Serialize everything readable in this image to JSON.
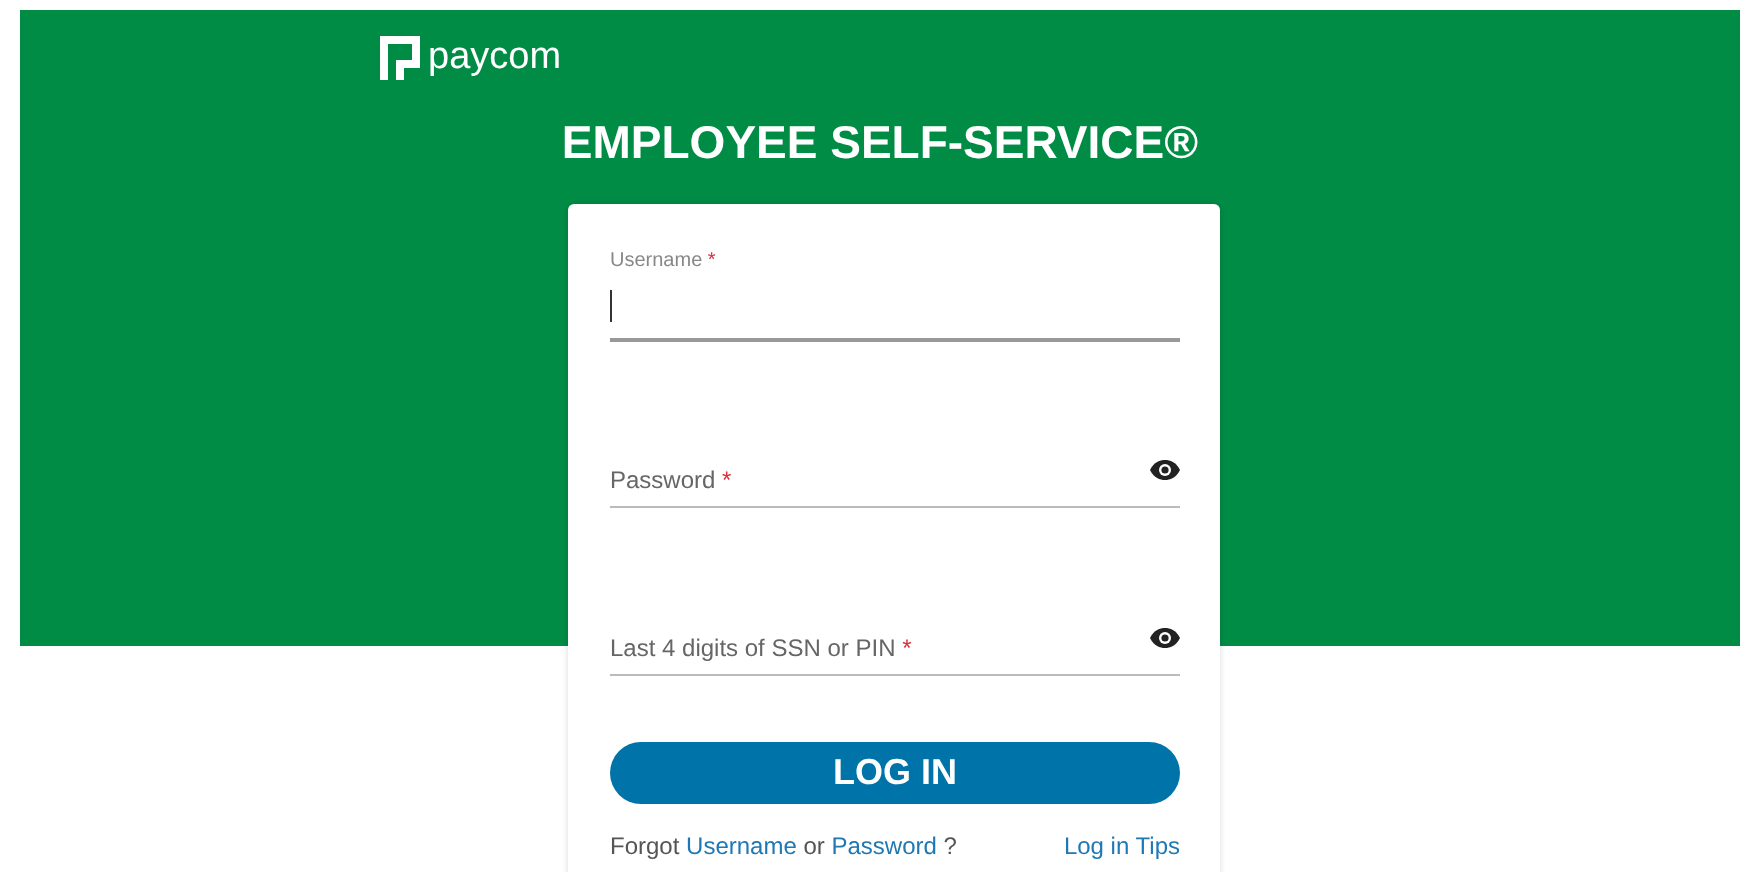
{
  "logo": {
    "text": "paycom"
  },
  "title": "EMPLOYEE SELF-SERVICE®",
  "fields": [
    {
      "label": "Username",
      "required_mark": "*",
      "focused": true,
      "reveal_toggle": false
    },
    {
      "label": "Password",
      "required_mark": "*",
      "focused": false,
      "reveal_toggle": true
    },
    {
      "label": "Last 4 digits of SSN or PIN",
      "required_mark": "*",
      "focused": false,
      "reveal_toggle": true
    }
  ],
  "login_button": "LOG IN",
  "footer": {
    "parts": [
      {
        "kind": "text",
        "text": "Forgot"
      },
      {
        "kind": "link",
        "text": "Username"
      },
      {
        "kind": "text",
        "text": "or"
      },
      {
        "kind": "link",
        "text": "Password"
      },
      {
        "kind": "text",
        "text": "?"
      }
    ],
    "tips_link": "Log in Tips"
  }
}
